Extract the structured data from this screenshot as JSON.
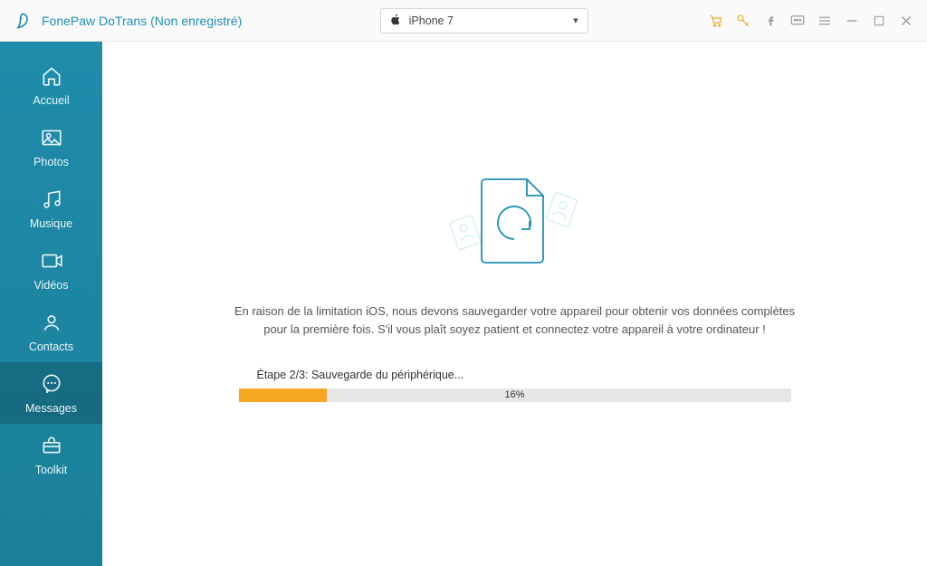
{
  "header": {
    "app_title": "FonePaw DoTrans (Non enregistré)",
    "device_name": "iPhone 7"
  },
  "sidebar": {
    "items": [
      {
        "label": "Accueil"
      },
      {
        "label": "Photos"
      },
      {
        "label": "Musique"
      },
      {
        "label": "Vidéos"
      },
      {
        "label": "Contacts"
      },
      {
        "label": "Messages"
      },
      {
        "label": "Toolkit"
      }
    ],
    "active_index": 5
  },
  "main": {
    "info_line1": "En raison de la limitation iOS, nous devons sauvegarder votre appareil pour obtenir vos données complètes",
    "info_line2": "pour la première fois. S'il vous plaît soyez patient et connectez votre appareil à votre ordinateur !",
    "step_text": "Étape 2/3: Sauvegarde du périphérique...",
    "progress_percent": 16,
    "progress_label": "16%"
  },
  "colors": {
    "teal": "#1f8cab",
    "orange": "#f5a623",
    "grey": "#9a9a9a"
  }
}
